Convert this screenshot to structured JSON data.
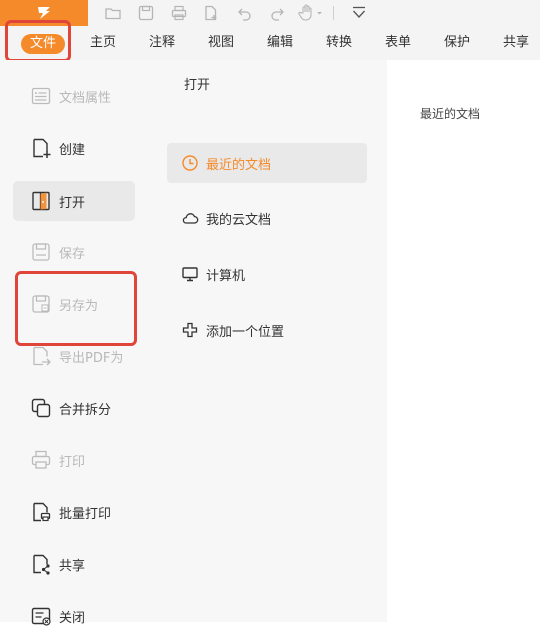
{
  "ribbon": {
    "tabs": [
      "文件",
      "主页",
      "注释",
      "视图",
      "编辑",
      "转换",
      "表单",
      "保护",
      "共享"
    ]
  },
  "quick_access": {
    "icons": [
      "open-folder-icon",
      "save-icon",
      "print-icon",
      "new-document-icon",
      "undo-icon",
      "redo-icon",
      "hand-tool-icon",
      "customize-dropdown-icon"
    ]
  },
  "file_menu": {
    "items": [
      {
        "label": "文档属性",
        "icon": "document-properties-icon",
        "disabled": true
      },
      {
        "label": "创建",
        "icon": "create-icon",
        "disabled": false
      },
      {
        "label": "打开",
        "icon": "open-icon",
        "disabled": false,
        "selected": true
      },
      {
        "label": "保存",
        "icon": "save-icon",
        "disabled": true
      },
      {
        "label": "另存为",
        "icon": "save-as-icon",
        "disabled": true
      },
      {
        "label": "导出PDF为",
        "icon": "export-pdf-icon",
        "disabled": true
      },
      {
        "label": "合并拆分",
        "icon": "merge-split-icon",
        "disabled": false
      },
      {
        "label": "打印",
        "icon": "print-icon",
        "disabled": true
      },
      {
        "label": "批量打印",
        "icon": "batch-print-icon",
        "disabled": false
      },
      {
        "label": "共享",
        "icon": "share-icon",
        "disabled": false
      },
      {
        "label": "关闭",
        "icon": "close-icon",
        "disabled": false
      }
    ]
  },
  "open_panel": {
    "title": "打开",
    "locations": [
      {
        "label": "最近的文档",
        "icon": "clock-icon",
        "selected": true
      },
      {
        "label": "我的云文档",
        "icon": "cloud-icon",
        "selected": false
      },
      {
        "label": "计算机",
        "icon": "computer-icon",
        "selected": false
      },
      {
        "label": "添加一个位置",
        "icon": "plus-icon",
        "selected": false
      }
    ]
  },
  "content": {
    "recent_label": "最近的文档"
  },
  "colors": {
    "accent": "#f58a2a",
    "highlight_box": "#e0453a",
    "panel_bg": "#f7f7f7",
    "selected_bg": "#e9e9e9",
    "disabled_text": "#b9b9b9"
  }
}
